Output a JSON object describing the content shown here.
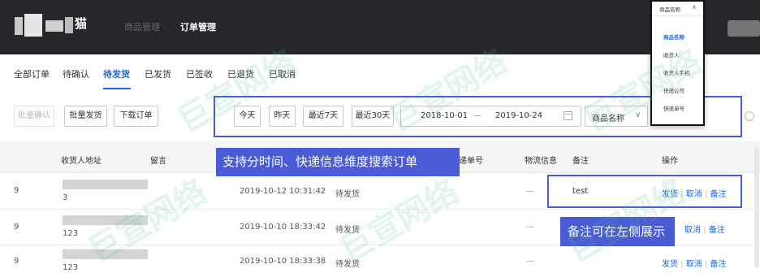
{
  "header": {
    "logo_text": "猫",
    "nav": [
      "商品管理",
      "订单管理"
    ]
  },
  "status_tabs": [
    "全部订单",
    "待确认",
    "待发货",
    "已发货",
    "已签收",
    "已退货",
    "已取消"
  ],
  "toolbar": {
    "batch_confirm": "批量确认",
    "batch_ship": "批量发货",
    "download_orders": "下载订单"
  },
  "filters": {
    "quick_dates": [
      "今天",
      "昨天",
      "最近7天",
      "最近30天"
    ],
    "date_start": "2018-10-01",
    "date_sep": "—",
    "date_end": "2019-10-24",
    "search_field": "商品名称",
    "chevron": "∨"
  },
  "dropdown": {
    "current": "商品名称",
    "chevron": "∧",
    "options": [
      "商品名称",
      "收货人",
      "收货人手机",
      "快递公司",
      "快递单号"
    ]
  },
  "table": {
    "headers": [
      "收货人地址",
      "留言",
      "递单号",
      "物流信息",
      "备注",
      "操作"
    ],
    "rows": [
      {
        "id_frag": "9",
        "addr_frag": "3",
        "time": "2019-10-12 10:31:42",
        "status": "待发货",
        "logistics": "—",
        "remark": "test"
      },
      {
        "id_frag": "9",
        "addr_frag": "123",
        "time": "2019-10-10 18:33:42",
        "status": "待发货",
        "logistics": "—",
        "remark": ""
      },
      {
        "id_frag": "9",
        "addr_frag": "123",
        "time": "2019-10-10 18:33:38",
        "status": "待发货",
        "logistics": "—",
        "remark": ""
      }
    ],
    "actions": [
      "发货",
      "取消",
      "备注"
    ],
    "action_sep": "|"
  },
  "annotations": {
    "search_tip": "支持分时间、快递信息维度搜索订单",
    "remark_tip": "备注可在左侧展示"
  },
  "watermark": "巨宣网络",
  "colors": {
    "accent": "#1d67d8",
    "annotation": "#4a5bd6",
    "topbar": "#26272b"
  }
}
